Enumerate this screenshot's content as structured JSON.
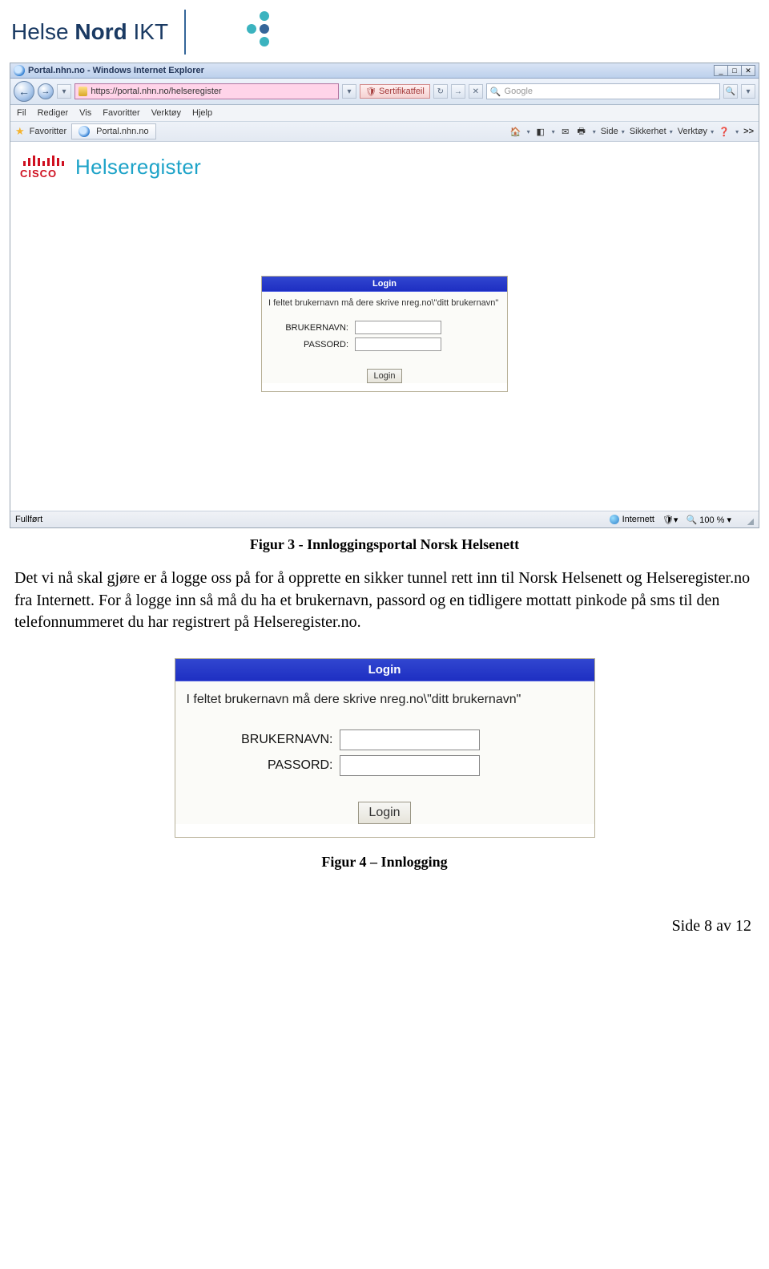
{
  "brand": {
    "first": "Helse ",
    "second": "Nord",
    "third": " IKT"
  },
  "browser": {
    "title": "Portal.nhn.no - Windows Internet Explorer",
    "address": "https://portal.nhn.no/helseregister",
    "cert": "Sertifikatfeil",
    "search_placeholder": "Google",
    "menus": {
      "fil": "Fil",
      "rediger": "Rediger",
      "vis": "Vis",
      "favoritter": "Favoritter",
      "verktoy": "Verktøy",
      "hjelp": "Hjelp"
    },
    "favbar": {
      "label": "Favoritter",
      "tab": "Portal.nhn.no"
    },
    "toolbar": {
      "side": "Side",
      "sikkerhet": "Sikkerhet",
      "verktoy": "Verktøy",
      "more": ">>"
    },
    "status": {
      "left": "Fullført",
      "zone": "Internett",
      "zoom": "100 %"
    }
  },
  "page": {
    "cisco": "CISCO",
    "heading": "Helseregister"
  },
  "login": {
    "title": "Login",
    "message": "I feltet brukernavn må dere skrive nreg.no\\\"ditt brukernavn\"",
    "user_label": "BRUKERNAVN:",
    "pass_label": "PASSORD:",
    "button": "Login"
  },
  "captions": {
    "fig3": "Figur 3 - Innloggingsportal Norsk Helsenett",
    "fig4": "Figur 4 – Innlogging"
  },
  "body_text": "Det vi nå skal gjøre er å logge oss på for å opprette en sikker tunnel rett inn til Norsk Helsenett og Helseregister.no fra Internett. For å logge inn så må du ha et brukernavn, passord og en tidligere mottatt pinkode på sms til den telefonnummeret du har registrert på Helseregister.no.",
  "footer": "Side 8 av 12"
}
